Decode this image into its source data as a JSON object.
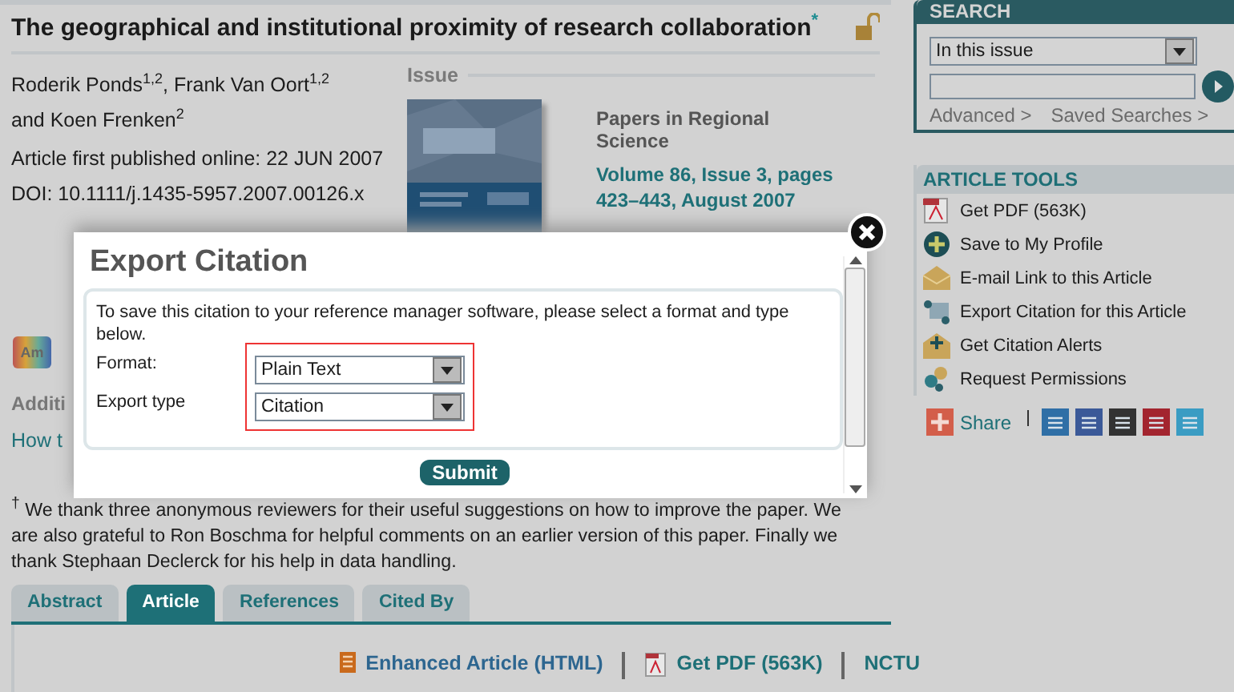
{
  "article": {
    "title": "The geographical and institutional proximity of research collaboration",
    "title_note": "*",
    "authors": [
      "Roderik Ponds$^{1,2}$,  Frank Van Oort$^{1,2}$",
      "and  Koen Frenken$^{2}$"
    ],
    "published": "Article first published online: 22 JUN 2007",
    "doi": "DOI: 10.1111/j.1435-5957.2007.00126.x"
  },
  "issue": {
    "heading": "Issue",
    "journal": "Papers in Regional Science",
    "citation": "Volume 86, Issue 3, pages 423–443, August 2007"
  },
  "badge": "Am",
  "additional_heading": "Additi",
  "how_link": "How t",
  "acknowledgement": "$^{†}$ We thank three anonymous reviewers for their useful suggestions on how to improve the paper. We are also grateful to Ron Boschma for helpful comments on an earlier version of this paper. Finally we thank Stephaan Declerck for his help in data handling.",
  "tabs": [
    {
      "label": "Abstract",
      "selected": false
    },
    {
      "label": "Article",
      "selected": true
    },
    {
      "label": "References",
      "selected": false
    },
    {
      "label": "Cited By",
      "selected": false
    }
  ],
  "content_links": [
    {
      "kind": "html",
      "label": "Enhanced Article (HTML)"
    },
    {
      "kind": "pdf",
      "label": "Get PDF (563K)"
    },
    {
      "kind": "plain",
      "label": "NCTU"
    }
  ],
  "search": {
    "title": "SEARCH",
    "scope": "In this issue",
    "links": [
      "Advanced >",
      "Saved Searches >"
    ]
  },
  "article_tools": {
    "title": "ARTICLE TOOLS",
    "items": [
      {
        "kind": "pdf",
        "label": "Get PDF (563K)"
      },
      {
        "kind": "save",
        "label": "Save to My Profile"
      },
      {
        "kind": "email",
        "label": "E-mail Link to this Article"
      },
      {
        "kind": "cite",
        "label": "Export Citation for this Article"
      },
      {
        "kind": "alert",
        "label": "Get Citation Alerts"
      },
      {
        "kind": "permission",
        "label": "Request Permissions"
      }
    ]
  },
  "share": {
    "label": "Share",
    "services": [
      {
        "color": "#2f6fa6"
      },
      {
        "color": "#3b5998"
      },
      {
        "color": "#333333"
      },
      {
        "color": "#a3252f"
      },
      {
        "color": "#3a9cc3"
      }
    ]
  },
  "dialog": {
    "title": "Export Citation",
    "intro": "To save this citation to your reference manager software, please select a format and type below.",
    "fields": [
      {
        "label": "Format:",
        "value": "Plain Text"
      },
      {
        "label": "Export type",
        "value": "Citation"
      }
    ],
    "submit": "Submit"
  }
}
